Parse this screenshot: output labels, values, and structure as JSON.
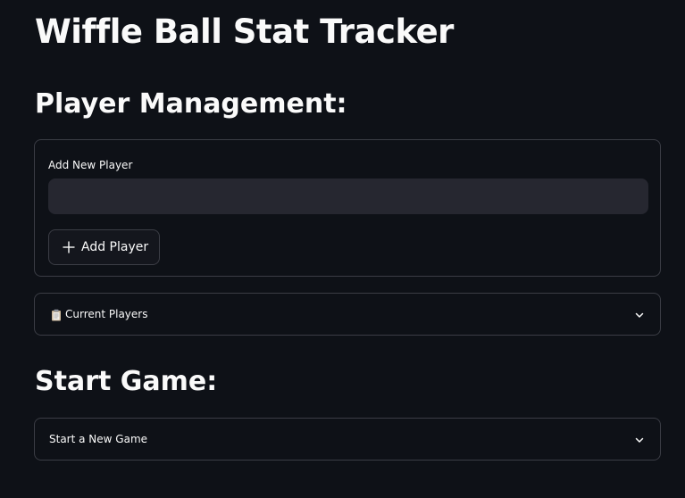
{
  "app": {
    "title": "Wiffle Ball Stat Tracker"
  },
  "player_management": {
    "heading": "Player Management:",
    "add_player_form": {
      "field_label": "Add New Player",
      "input_value": "",
      "input_placeholder": "",
      "button_label": "Add Player",
      "button_icon": "plus-icon"
    },
    "current_players_expander": {
      "icon": "clipboard-icon",
      "label": "Current Players",
      "chevron_icon": "chevron-down-icon"
    }
  },
  "start_game": {
    "heading": "Start Game:",
    "new_game_expander": {
      "label": "Start a New Game",
      "chevron_icon": "chevron-down-icon"
    }
  },
  "colors": {
    "background": "#0e1117",
    "text": "#fafafa",
    "input_background": "#262730",
    "border": "#3b3d45"
  }
}
